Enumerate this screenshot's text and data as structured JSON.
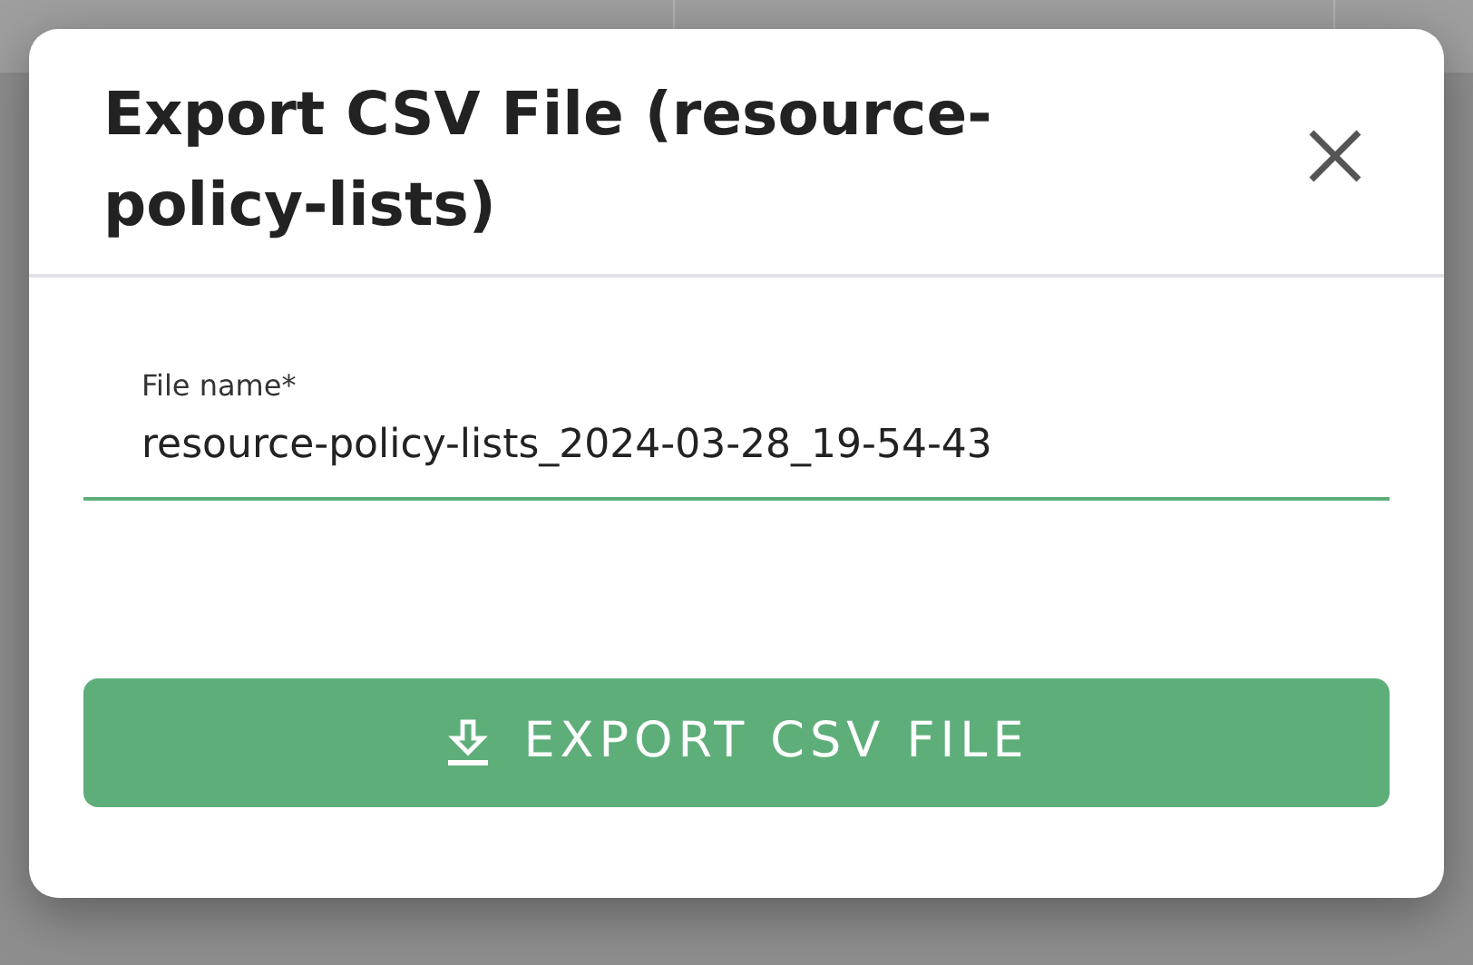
{
  "dialog": {
    "title": "Export CSV File (resource-policy-lists)"
  },
  "field": {
    "label": "File name*",
    "value": "resource-policy-lists_2024-03-28_19-54-43"
  },
  "button": {
    "label": "EXPORT CSV FILE"
  }
}
